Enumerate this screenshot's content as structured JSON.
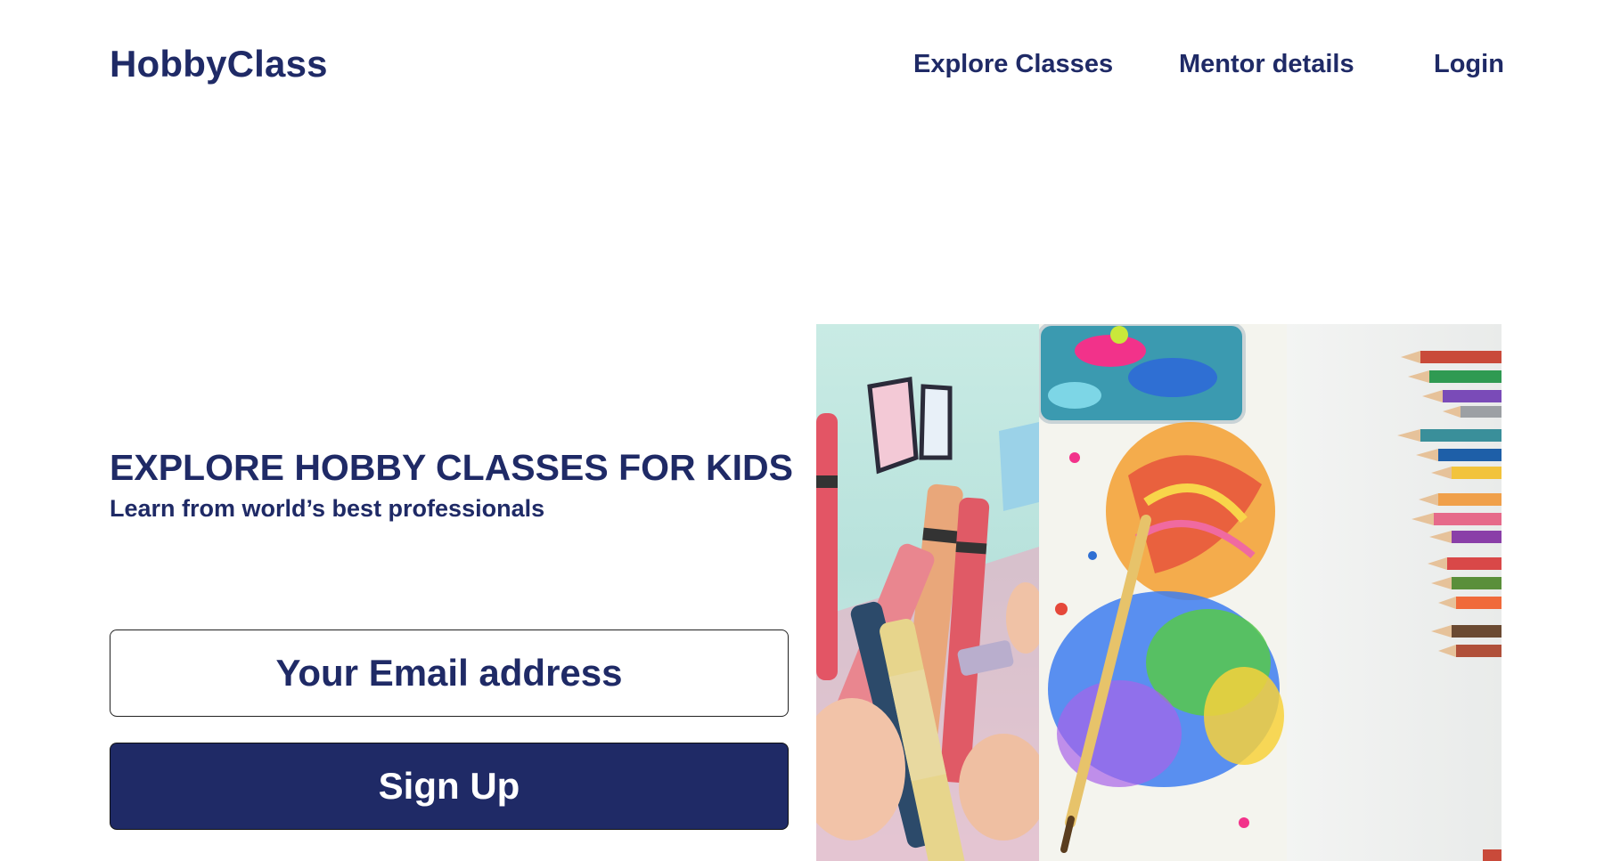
{
  "header": {
    "logo": "HobbyClass",
    "nav": [
      "Explore Classes",
      "Mentor details",
      "Login"
    ]
  },
  "hero": {
    "title": "EXPLORE HOBBY CLASSES FOR KIDS",
    "subtitle": "Learn from world’s best professionals"
  },
  "form": {
    "email_placeholder": "Your Email address",
    "signup_label": "Sign Up"
  },
  "colors": {
    "primary": "#1f2a66",
    "background": "#ffffff"
  },
  "gallery": {
    "images": [
      "crayons-photo",
      "paint-splatter-photo",
      "colored-pencils-photo"
    ]
  }
}
